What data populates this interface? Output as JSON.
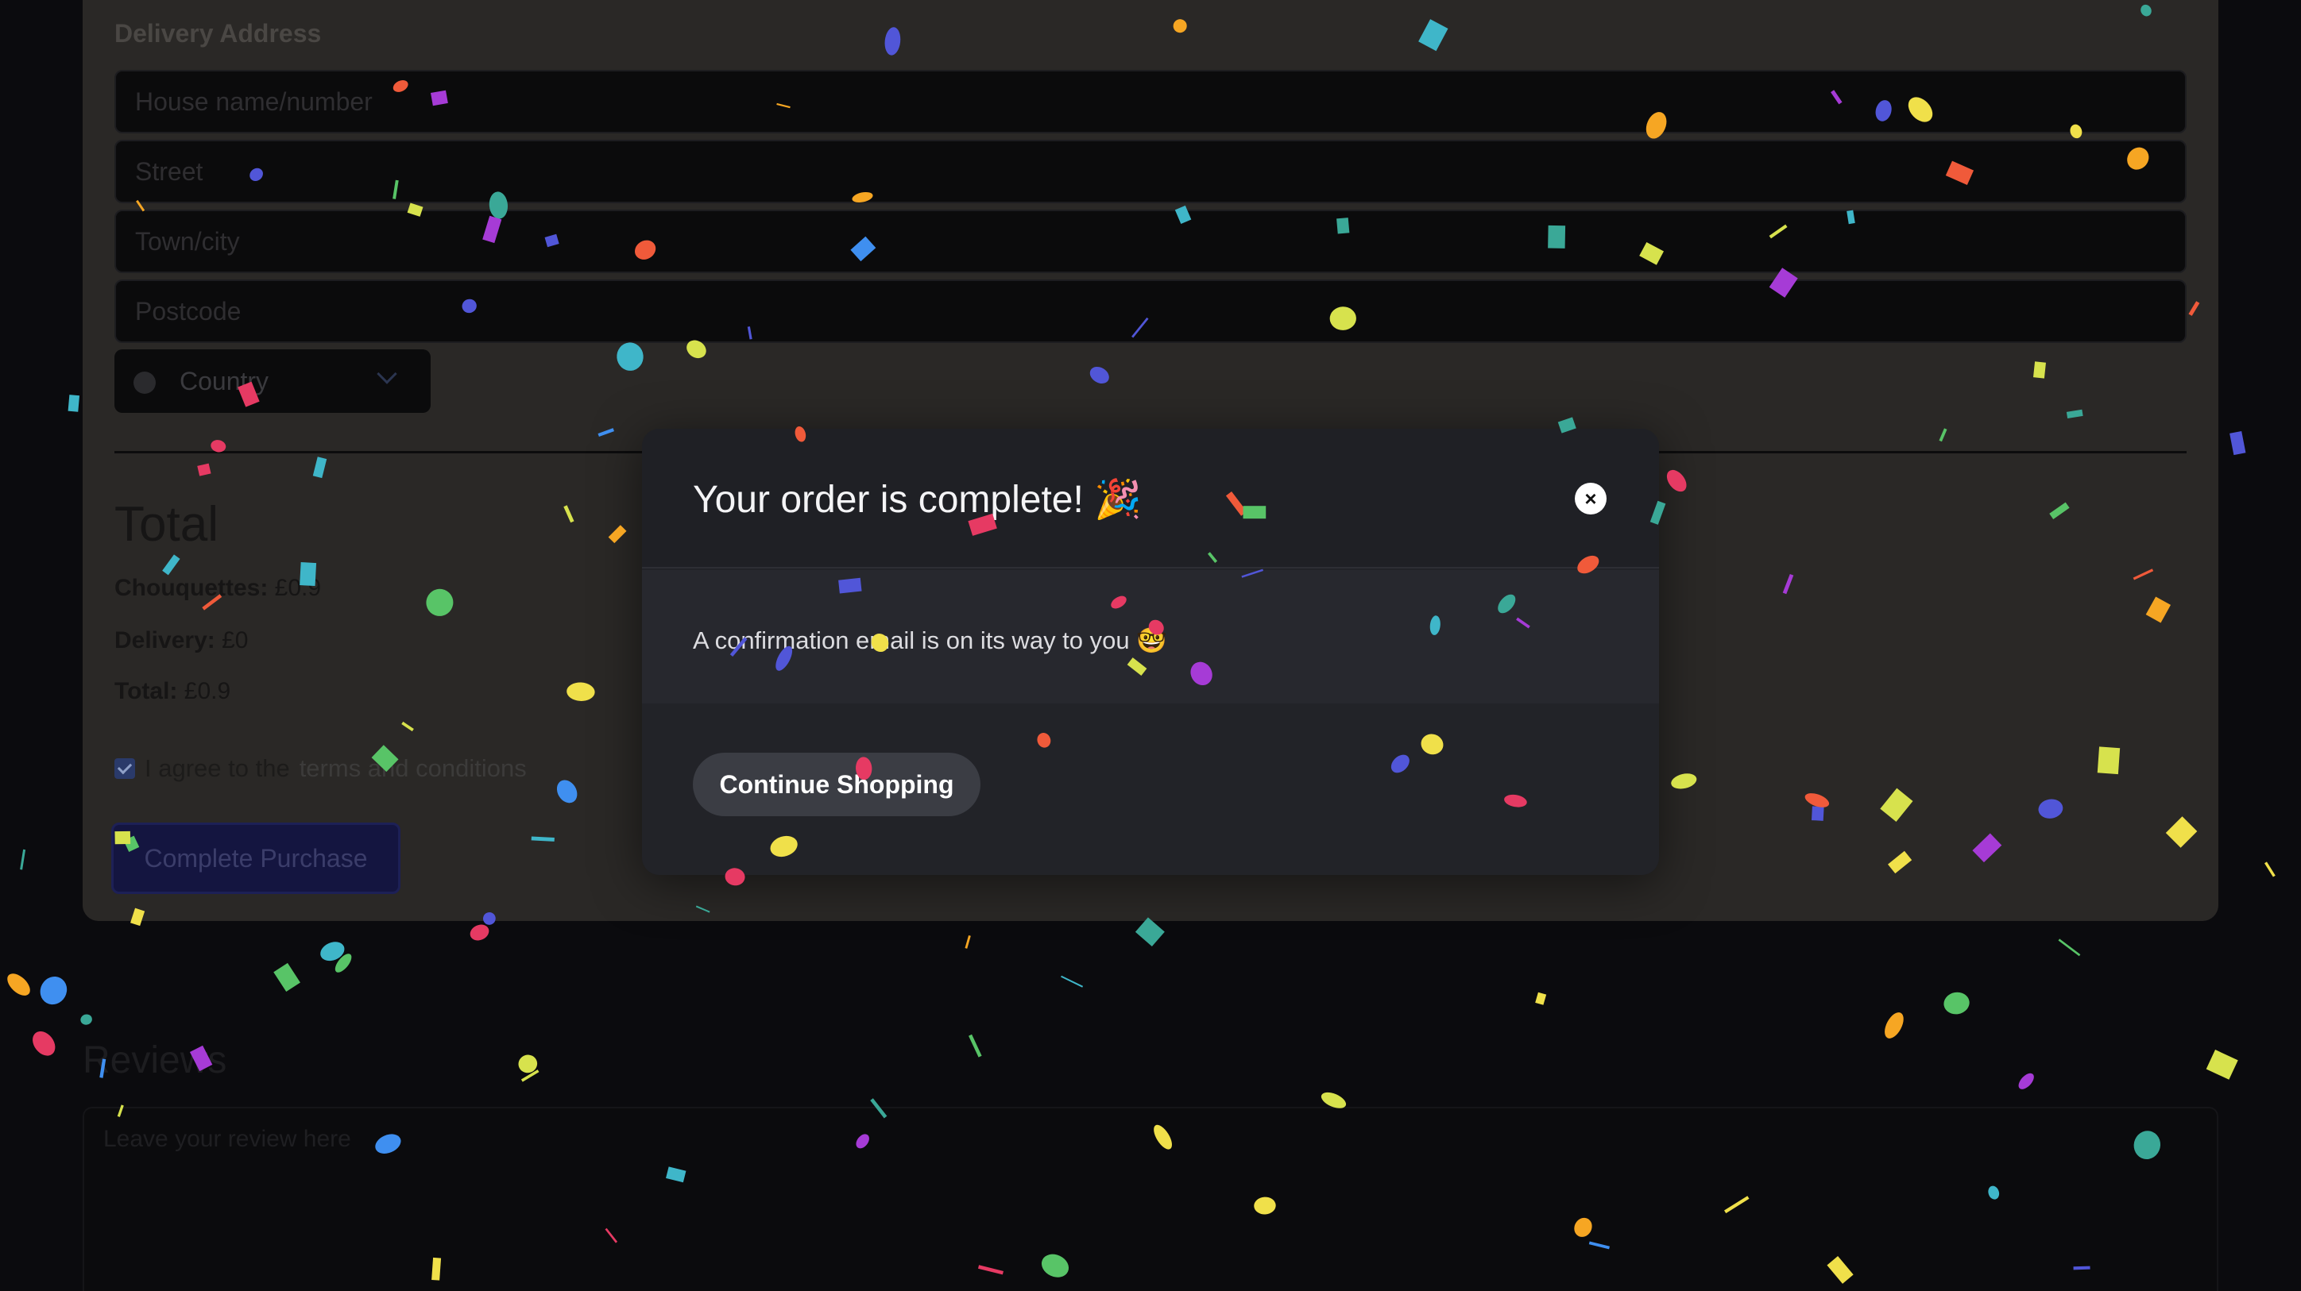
{
  "delivery": {
    "section_label": "Delivery Address",
    "fields": [
      {
        "placeholder": "House name/number"
      },
      {
        "placeholder": "Street"
      },
      {
        "placeholder": "Town/city"
      },
      {
        "placeholder": "Postcode"
      }
    ],
    "country_placeholder": "Country"
  },
  "summary": {
    "heading": "Total",
    "item_label": "Chouquettes:",
    "item_value": "£0.9",
    "delivery_label": "Delivery:",
    "delivery_value": "£0",
    "total_label": "Total:",
    "total_value": "£0.9"
  },
  "terms": {
    "checked": true,
    "prefix": "I agree to the",
    "link": "terms and conditions"
  },
  "purchase_button": "Complete Purchase",
  "reviews": {
    "title": "Reviews",
    "placeholder": "Leave your review here"
  },
  "modal": {
    "title": "Your order is complete! 🎉",
    "close_symbol": "×",
    "message": "A confirmation email is on its way to you 🤓",
    "continue_button": "Continue Shopping"
  },
  "confetti_colors": [
    "#e63a63",
    "#3f8ff0",
    "#58c467",
    "#a63bd6",
    "#f6a623",
    "#f0e04a",
    "#3fb6c9",
    "#3aa897",
    "#5156d8",
    "#f05a3a",
    "#d7e24d"
  ]
}
